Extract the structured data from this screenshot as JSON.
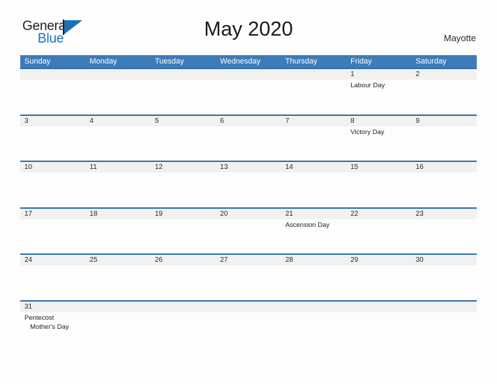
{
  "brand": {
    "name_top": "General",
    "name_bottom": "Blue",
    "flag_icon": "blue-flag-triangle",
    "accent_color": "#1f6fb8"
  },
  "header": {
    "title": "May 2020",
    "locale": "Mayotte"
  },
  "calendar": {
    "header_bg": "#3d7cba",
    "row_divider_color": "#2f6fae",
    "date_band_bg": "#f1f1f1",
    "weekdays": [
      "Sunday",
      "Monday",
      "Tuesday",
      "Wednesday",
      "Thursday",
      "Friday",
      "Saturday"
    ],
    "weeks": [
      {
        "days": [
          {
            "number": "",
            "events": []
          },
          {
            "number": "",
            "events": []
          },
          {
            "number": "",
            "events": []
          },
          {
            "number": "",
            "events": []
          },
          {
            "number": "",
            "events": []
          },
          {
            "number": "1",
            "events": [
              "Labour Day"
            ]
          },
          {
            "number": "2",
            "events": []
          }
        ]
      },
      {
        "days": [
          {
            "number": "3",
            "events": []
          },
          {
            "number": "4",
            "events": []
          },
          {
            "number": "5",
            "events": []
          },
          {
            "number": "6",
            "events": []
          },
          {
            "number": "7",
            "events": []
          },
          {
            "number": "8",
            "events": [
              "Victory Day"
            ]
          },
          {
            "number": "9",
            "events": []
          }
        ]
      },
      {
        "days": [
          {
            "number": "10",
            "events": []
          },
          {
            "number": "11",
            "events": []
          },
          {
            "number": "12",
            "events": []
          },
          {
            "number": "13",
            "events": []
          },
          {
            "number": "14",
            "events": []
          },
          {
            "number": "15",
            "events": []
          },
          {
            "number": "16",
            "events": []
          }
        ]
      },
      {
        "days": [
          {
            "number": "17",
            "events": []
          },
          {
            "number": "18",
            "events": []
          },
          {
            "number": "19",
            "events": []
          },
          {
            "number": "20",
            "events": []
          },
          {
            "number": "21",
            "events": [
              "Ascension Day"
            ]
          },
          {
            "number": "22",
            "events": []
          },
          {
            "number": "23",
            "events": []
          }
        ]
      },
      {
        "days": [
          {
            "number": "24",
            "events": []
          },
          {
            "number": "25",
            "events": []
          },
          {
            "number": "26",
            "events": []
          },
          {
            "number": "27",
            "events": []
          },
          {
            "number": "28",
            "events": []
          },
          {
            "number": "29",
            "events": []
          },
          {
            "number": "30",
            "events": []
          }
        ]
      },
      {
        "days": [
          {
            "number": "31",
            "events": [
              "Pentecost",
              "Mother's Day"
            ]
          },
          {
            "number": "",
            "events": []
          },
          {
            "number": "",
            "events": []
          },
          {
            "number": "",
            "events": []
          },
          {
            "number": "",
            "events": []
          },
          {
            "number": "",
            "events": []
          },
          {
            "number": "",
            "events": []
          }
        ]
      }
    ]
  }
}
